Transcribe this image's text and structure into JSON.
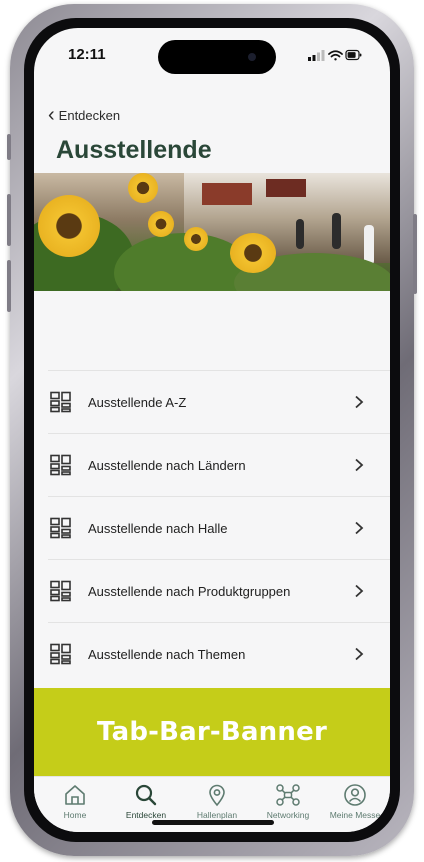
{
  "status_bar": {
    "time": "12:11",
    "icons": [
      "signal-icon",
      "wifi-icon",
      "battery-icon"
    ]
  },
  "nav": {
    "back_label": "Entdecken"
  },
  "page": {
    "title": "Ausstellende"
  },
  "menu": {
    "items": [
      {
        "label": "Ausstellende A-Z",
        "icon": "list-grid-icon"
      },
      {
        "label": "Ausstellende nach Ländern",
        "icon": "list-grid-icon"
      },
      {
        "label": "Ausstellende nach Halle",
        "icon": "list-grid-icon"
      },
      {
        "label": "Ausstellende nach Produktgruppen",
        "icon": "list-grid-icon"
      },
      {
        "label": "Ausstellende nach Themen",
        "icon": "list-grid-icon"
      }
    ]
  },
  "banner": {
    "text": "Tab-Bar-Banner",
    "color": "#c5cd19"
  },
  "tabbar": {
    "tabs": [
      {
        "label": "Home",
        "icon": "home-icon"
      },
      {
        "label": "Entdecken",
        "icon": "search-icon",
        "active": true
      },
      {
        "label": "Hallenplan",
        "icon": "location-pin-icon"
      },
      {
        "label": "Networking",
        "icon": "network-icon"
      },
      {
        "label": "Meine Messe",
        "icon": "user-circle-icon"
      }
    ]
  },
  "colors": {
    "title": "#2a4738",
    "tab_icon": "#5e7b70",
    "background": "#f6f6f7"
  }
}
